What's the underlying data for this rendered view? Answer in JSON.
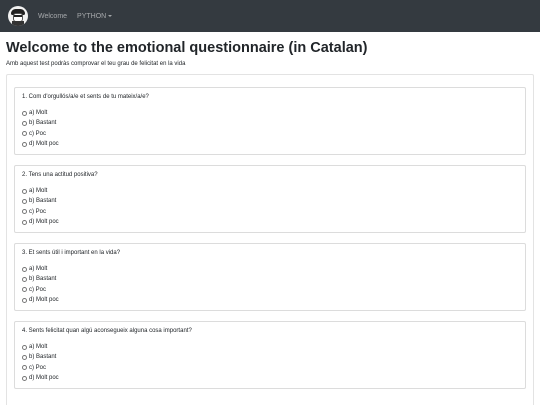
{
  "navbar": {
    "links": [
      "Welcome",
      "PYTHON"
    ]
  },
  "page": {
    "title": "Welcome to the emotional questionnaire (in Catalan)",
    "subtitle": "Amb aquest test podràs comprovar el teu grau de felicitat en la vida"
  },
  "questions": [
    {
      "text": "1. Com d'orgullós/a/e et sents de tu mateix/a/e?",
      "options": [
        "a) Molt",
        "b) Bastant",
        "c) Poc",
        "d) Molt poc"
      ]
    },
    {
      "text": "2. Tens una actitud positiva?",
      "options": [
        "a) Molt",
        "b) Bastant",
        "c) Poc",
        "d) Molt poc"
      ]
    },
    {
      "text": "3. Et sents útil i important en la vida?",
      "options": [
        "a) Molt",
        "b) Bastant",
        "c) Poc",
        "d) Molt poc"
      ]
    },
    {
      "text": "4. Sents felicitat quan algú aconsegueix alguna cosa important?",
      "options": [
        "a) Molt",
        "b) Bastant",
        "c) Poc",
        "d) Molt poc"
      ]
    }
  ]
}
